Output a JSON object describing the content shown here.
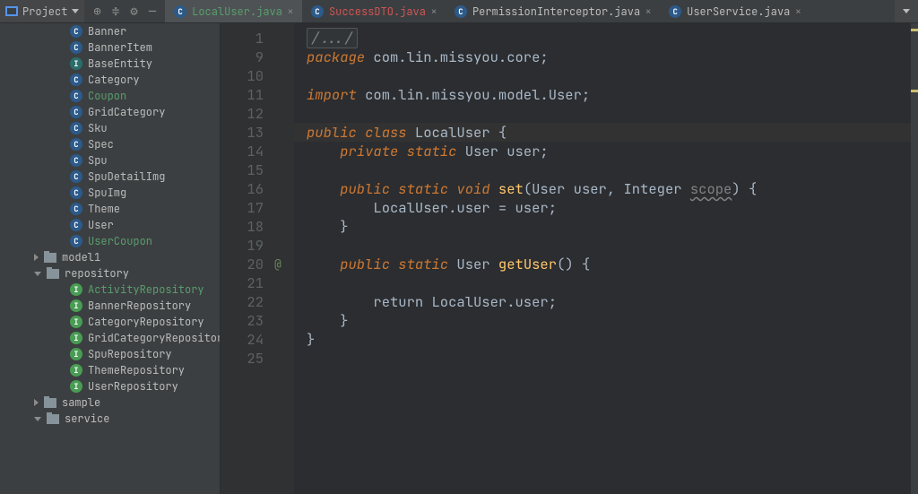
{
  "toolbar": {
    "project_label": "Project"
  },
  "tabs": [
    {
      "label": "LocalUser.java",
      "icon": "c-blue",
      "labelClass": "green",
      "active": true
    },
    {
      "label": "SuccessDTO.java",
      "icon": "c-blue",
      "labelClass": "red",
      "active": false
    },
    {
      "label": "PermissionInterceptor.java",
      "icon": "c-blue",
      "labelClass": "",
      "active": false
    },
    {
      "label": "UserService.java",
      "icon": "c-blue",
      "labelClass": "",
      "active": false
    }
  ],
  "tree": {
    "items": [
      {
        "indent": 78,
        "icon": "c-blue",
        "iconLetter": "C",
        "label": "Banner",
        "labelClass": ""
      },
      {
        "indent": 78,
        "icon": "c-blue",
        "iconLetter": "C",
        "label": "BannerItem",
        "labelClass": ""
      },
      {
        "indent": 78,
        "icon": "c-teal",
        "iconLetter": "I",
        "label": "BaseEntity",
        "labelClass": ""
      },
      {
        "indent": 78,
        "icon": "c-blue",
        "iconLetter": "C",
        "label": "Category",
        "labelClass": ""
      },
      {
        "indent": 78,
        "icon": "c-blue",
        "iconLetter": "C",
        "label": "Coupon",
        "labelClass": "green"
      },
      {
        "indent": 78,
        "icon": "c-blue",
        "iconLetter": "C",
        "label": "GridCategory",
        "labelClass": ""
      },
      {
        "indent": 78,
        "icon": "c-blue",
        "iconLetter": "C",
        "label": "Sku",
        "labelClass": ""
      },
      {
        "indent": 78,
        "icon": "c-blue",
        "iconLetter": "C",
        "label": "Spec",
        "labelClass": ""
      },
      {
        "indent": 78,
        "icon": "c-blue",
        "iconLetter": "C",
        "label": "Spu",
        "labelClass": ""
      },
      {
        "indent": 78,
        "icon": "c-blue",
        "iconLetter": "C",
        "label": "SpuDetailImg",
        "labelClass": ""
      },
      {
        "indent": 78,
        "icon": "c-blue",
        "iconLetter": "C",
        "label": "SpuImg",
        "labelClass": ""
      },
      {
        "indent": 78,
        "icon": "c-blue",
        "iconLetter": "C",
        "label": "Theme",
        "labelClass": ""
      },
      {
        "indent": 78,
        "icon": "c-blue",
        "iconLetter": "C",
        "label": "User",
        "labelClass": ""
      },
      {
        "indent": 78,
        "icon": "c-blue",
        "iconLetter": "C",
        "label": "UserCoupon",
        "labelClass": "green"
      },
      {
        "indent": 38,
        "arrow": "right",
        "icon": "folder",
        "label": "model1",
        "labelClass": ""
      },
      {
        "indent": 38,
        "arrow": "down",
        "icon": "folder",
        "label": "repository",
        "labelClass": ""
      },
      {
        "indent": 78,
        "icon": "c-green",
        "iconLetter": "I",
        "label": "ActivityRepository",
        "labelClass": "green"
      },
      {
        "indent": 78,
        "icon": "c-green",
        "iconLetter": "I",
        "label": "BannerRepository",
        "labelClass": ""
      },
      {
        "indent": 78,
        "icon": "c-green",
        "iconLetter": "I",
        "label": "CategoryRepository",
        "labelClass": ""
      },
      {
        "indent": 78,
        "icon": "c-green",
        "iconLetter": "I",
        "label": "GridCategoryRepository",
        "labelClass": ""
      },
      {
        "indent": 78,
        "icon": "c-green",
        "iconLetter": "I",
        "label": "SpuRepository",
        "labelClass": ""
      },
      {
        "indent": 78,
        "icon": "c-green",
        "iconLetter": "I",
        "label": "ThemeRepository",
        "labelClass": ""
      },
      {
        "indent": 78,
        "icon": "c-green",
        "iconLetter": "I",
        "label": "UserRepository",
        "labelClass": ""
      },
      {
        "indent": 38,
        "arrow": "right",
        "icon": "folder",
        "label": "sample",
        "labelClass": ""
      },
      {
        "indent": 38,
        "arrow": "down",
        "icon": "folder",
        "label": "service",
        "labelClass": ""
      }
    ]
  },
  "editor": {
    "line_numbers": [
      "1",
      "9",
      "10",
      "11",
      "12",
      "13",
      "14",
      "15",
      "16",
      "17",
      "18",
      "19",
      "20",
      "21",
      "22",
      "23",
      "24",
      "25"
    ],
    "gutter_marks": {
      "12": "@"
    },
    "current_line_index": 5,
    "code": {
      "fold_label": "/.../",
      "package_kw": "package ",
      "package_name": "com.lin.missyou.core;",
      "import_kw": "import ",
      "import_name": "com.lin.missyou.model.User;",
      "class_decl_pre": "public class ",
      "class_name": "LocalUser ",
      "open_brace": "{",
      "field_pre": "    private static ",
      "field_type": "User ",
      "field_name": "user",
      "semicolon": ";",
      "set_pre": "    public static void ",
      "set_name": "set",
      "set_sig_open": "(",
      "set_param1_t": "User ",
      "set_param1_n": "user, ",
      "set_param2_t": "Integer ",
      "set_param2_n": "scope",
      "set_sig_close": ") {",
      "set_body": "        LocalUser.user = user;",
      "close_brace": "    }",
      "get_pre": "    public static ",
      "get_type": "User ",
      "get_name": "getUser",
      "get_sig": "() {",
      "get_body": "        return LocalUser.user;",
      "outer_close": "}"
    }
  }
}
